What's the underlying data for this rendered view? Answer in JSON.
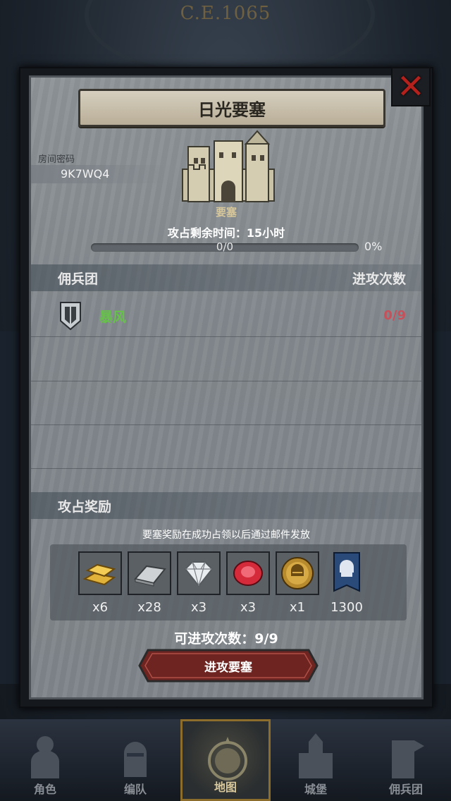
{
  "era": "C.E.1065",
  "modal": {
    "title": "日光要塞",
    "close_icon": "close-x-icon",
    "room_label": "房间密码",
    "room_code": "9K7WQ4",
    "castle_name": "要塞",
    "remaining_time": "攻占剩余时间：15小时",
    "progress_text": "0/0",
    "progress_percent": "0%",
    "progress_fraction": 0,
    "mercenary": {
      "header_left": "佣兵团",
      "header_right": "进攻次数",
      "rows": [
        {
          "name": "暴风",
          "count": "0/9",
          "icon": "shield-icon"
        }
      ]
    },
    "reward": {
      "header": "攻占奖励",
      "note": "要塞奖励在成功占领以后通过邮件发放",
      "items": [
        {
          "icon": "gold-bar-icon",
          "qty": "x6"
        },
        {
          "icon": "iron-ingot-icon",
          "qty": "x28"
        },
        {
          "icon": "diamond-icon",
          "qty": "x3"
        },
        {
          "icon": "ruby-icon",
          "qty": "x3"
        },
        {
          "icon": "knight-medal-icon",
          "qty": "x1"
        },
        {
          "icon": "banner-icon",
          "qty": "1300"
        }
      ]
    },
    "available_attacks": "可进攻次数：9/9",
    "attack_button": "进攻要塞"
  },
  "nav": [
    {
      "label": "角色",
      "icon": "character-icon"
    },
    {
      "label": "编队",
      "icon": "formation-icon"
    },
    {
      "label": "地图",
      "icon": "map-icon",
      "active": true
    },
    {
      "label": "城堡",
      "icon": "castle-icon"
    },
    {
      "label": "佣兵团",
      "icon": "mercenary-icon"
    }
  ],
  "colors": {
    "accent_green": "#67c24a",
    "count_red": "#c8505a",
    "button_red": "#7a2a26",
    "gold": "#d7c79a"
  }
}
